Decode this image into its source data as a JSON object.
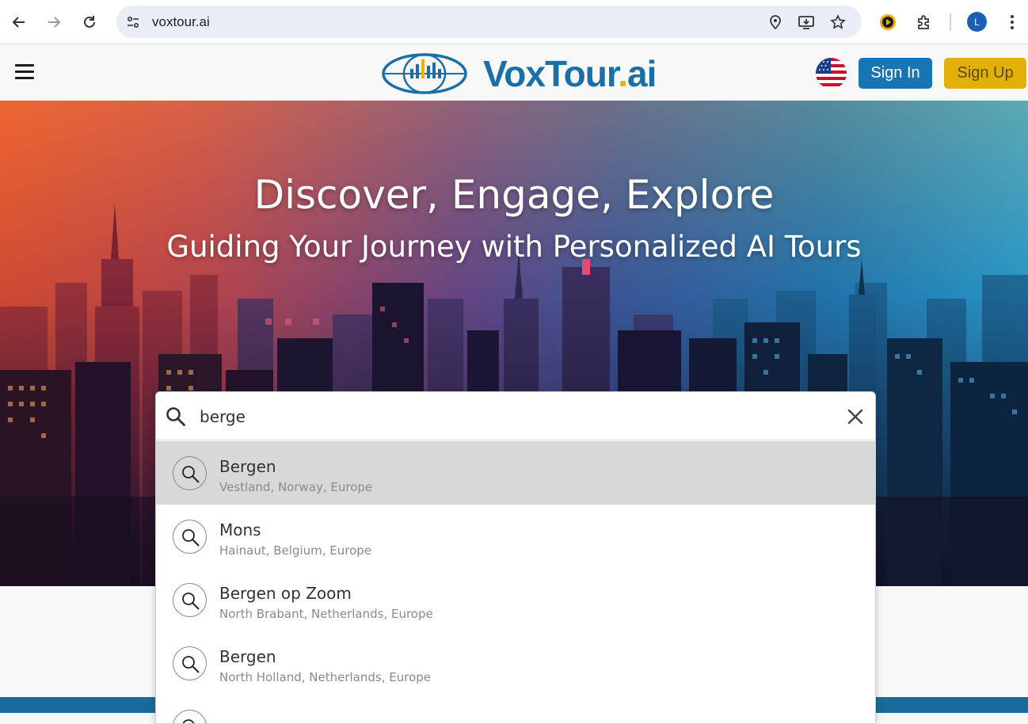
{
  "browser": {
    "url": "voxtour.ai",
    "profile_initial": "L"
  },
  "header": {
    "logo_main": "VoxTour",
    "logo_dot": ".",
    "logo_suffix": "ai",
    "sign_in": "Sign In",
    "sign_up": "Sign Up",
    "language_flag": "us-flag-icon"
  },
  "hero": {
    "title": "Discover, Engage, Explore",
    "subtitle": "Guiding Your Journey with Personalized AI Tours"
  },
  "search": {
    "value": "berge",
    "results": [
      {
        "name": "Bergen",
        "location": "Vestland, Norway, Europe",
        "highlighted": true
      },
      {
        "name": "Mons",
        "location": "Hainaut, Belgium, Europe",
        "highlighted": false
      },
      {
        "name": "Bergen op Zoom",
        "location": "North Brabant, Netherlands, Europe",
        "highlighted": false
      },
      {
        "name": "Bergen",
        "location": "North Holland, Netherlands, Europe",
        "highlighted": false
      }
    ]
  },
  "colors": {
    "brand_blue": "#1a6fa8",
    "signin_bg": "#1775b3",
    "signup_bg": "#e2b007",
    "highlight_row": "#d8d8d8"
  }
}
